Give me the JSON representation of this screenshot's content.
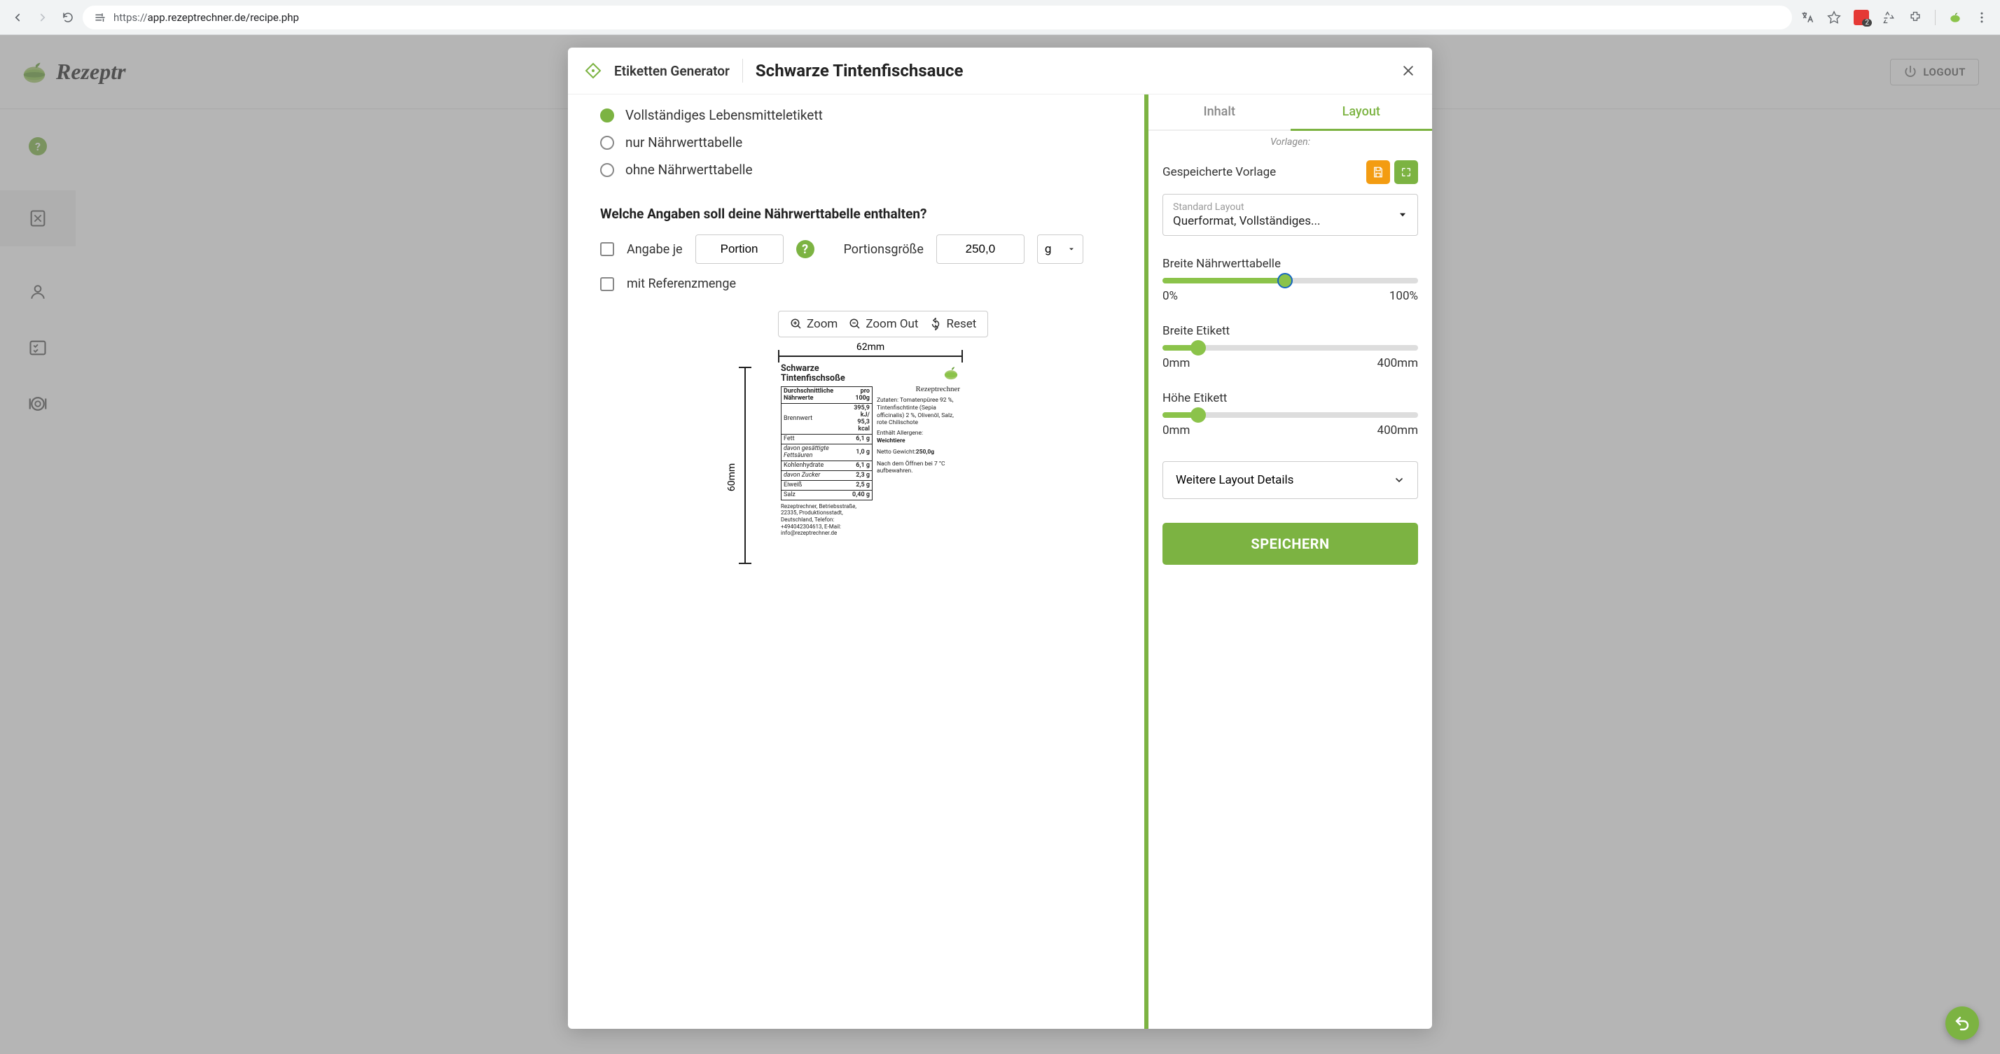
{
  "browser": {
    "url_prefix": "https://",
    "url_rest": "app.rezeptrechner.de/recipe.php"
  },
  "app": {
    "logo_text": "Rezeptr",
    "logout": "LOGOUT"
  },
  "modal": {
    "subtitle": "Etiketten Generator",
    "title": "Schwarze Tintenfischsauce",
    "radios": [
      {
        "label": "Vollständiges Lebensmitteletikett",
        "checked": true
      },
      {
        "label": "nur Nährwerttabelle",
        "checked": false
      },
      {
        "label": "ohne Nährwerttabelle",
        "checked": false
      }
    ],
    "section_question": "Welche Angaben soll deine Nährwerttabelle enthalten?",
    "angabe_je": "Angabe je",
    "portion_value": "Portion",
    "portionsgroesse": "Portionsgröße",
    "portionsgroesse_value": "250,0",
    "unit": "g",
    "mit_referenzmenge": "mit Referenzmenge",
    "zoom": "Zoom",
    "zoom_out": "Zoom Out",
    "reset": "Reset",
    "ruler_h": "62mm",
    "ruler_v": "60mm",
    "preview": {
      "title": "Schwarze Tintenfischsoße",
      "logo_text": "Rezeptrechner",
      "th_left": "Durchschnittliche Nährwerte",
      "th_right": "pro 100g",
      "rows": [
        {
          "name": "Brennwert",
          "val": "395,9 kJ/",
          "val2": "95,3 kcal"
        },
        {
          "name": "Fett",
          "val": "6,1 g"
        },
        {
          "name": "davon gesättigte Fettsäuren",
          "val": "1,0 g",
          "ital": true
        },
        {
          "name": "Kohlenhydrate",
          "val": "6,1 g"
        },
        {
          "name": "davon Zucker",
          "val": "2,3 g",
          "ital": true
        },
        {
          "name": "Eiweiß",
          "val": "2,5 g"
        },
        {
          "name": "Salz",
          "val": "0,40 g"
        }
      ],
      "footer": "Rezeptrechner, Betriebsstraße, 22335, Produktionsstadt, Deutschland, Telefon: +494042304613, E-Mail: info@rezeptrechner.de",
      "ingredients": "Zutaten: Tomatenpüree 92 %, Tintenfischtinte (Sepia officinalis) 2 %, Olivenöl, Salz, rote Chilischote",
      "allergen_h": "Enthält Allergene:",
      "allergen": "Weichtiere",
      "netweight_l": "Netto Gewicht:",
      "netweight_v": "250,0g",
      "storage": "Nach dem Öffnen bei 7 °C aufbewahren."
    }
  },
  "right": {
    "tab_inhalt": "Inhalt",
    "tab_layout": "Layout",
    "vorlagen": "Vorlagen:",
    "saved": "Gespeicherte Vorlage",
    "sel_label": "Standard Layout",
    "sel_value": "Querformat, Vollständiges...",
    "sliders": [
      {
        "label": "Breite Nährwerttabelle",
        "min": "0%",
        "max": "100%",
        "pct": 48,
        "ring": true
      },
      {
        "label": "Breite Etikett",
        "min": "0mm",
        "max": "400mm",
        "pct": 14
      },
      {
        "label": "Höhe Etikett",
        "min": "0mm",
        "max": "400mm",
        "pct": 14
      }
    ],
    "details": "Weitere Layout Details",
    "save": "SPEICHERN"
  }
}
